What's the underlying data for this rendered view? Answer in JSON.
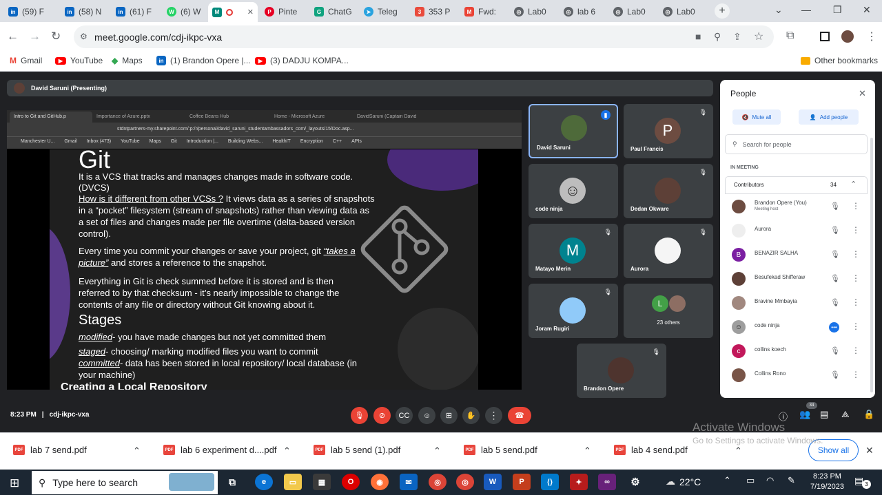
{
  "browser": {
    "tabs": [
      {
        "label": "(59) F",
        "icon": "linkedin-icon",
        "color": "#0a66c2",
        "glyph": "in"
      },
      {
        "label": "(58) N",
        "icon": "linkedin-icon",
        "color": "#0a66c2",
        "glyph": "in"
      },
      {
        "label": "(61) F",
        "icon": "linkedin-icon",
        "color": "#0a66c2",
        "glyph": "in"
      },
      {
        "label": "(6) W",
        "icon": "whatsapp-icon",
        "color": "#25d366",
        "glyph": "W"
      },
      {
        "label": "",
        "icon": "meet-icon",
        "color": "#00897b",
        "glyph": "M"
      },
      {
        "label": "Pinte",
        "icon": "pinterest-icon",
        "color": "#e60023",
        "glyph": "P"
      },
      {
        "label": "ChatG",
        "icon": "chatgpt-icon",
        "color": "#10a37f",
        "glyph": "G"
      },
      {
        "label": "Teleg",
        "icon": "telegram-icon",
        "color": "#2aa3df",
        "glyph": "T"
      },
      {
        "label": "353 P",
        "icon": "tab-app-icon",
        "color": "#e94b3c",
        "glyph": "3"
      },
      {
        "label": "Fwd:",
        "icon": "gmail-icon",
        "color": "#ea4335",
        "glyph": "M"
      },
      {
        "label": "Lab0",
        "icon": "globe-icon",
        "color": "#5f6368",
        "glyph": "◎"
      },
      {
        "label": "lab 6",
        "icon": "globe-icon",
        "color": "#5f6368",
        "glyph": "◎"
      },
      {
        "label": "Lab0",
        "icon": "globe-icon",
        "color": "#5f6368",
        "glyph": "◎"
      },
      {
        "label": "Lab0",
        "icon": "globe-icon",
        "color": "#5f6368",
        "glyph": "◎"
      }
    ],
    "url": "meet.google.com/cdj-ikpc-vxa",
    "bookmarks": [
      "Gmail",
      "YouTube",
      "Maps",
      "(1) Brandon Opere |...",
      "(3) DADJU KOMPA..."
    ],
    "other_bookmarks": "Other bookmarks"
  },
  "meet": {
    "presenter": "David Saruni (Presenting)",
    "time": "8:23 PM",
    "code": "cdj-ikpc-vxa",
    "participant_badge": "34"
  },
  "shared": {
    "tabs": [
      "Intro to Git and GitHub.p",
      "Importance of Azure.pptx",
      "Coffee Beans Hub",
      "Home - Microsoft Azure",
      "DavidSaruni (Captain David"
    ],
    "url": "stdntpartners-my.sharepoint.com/:p:/r/personal/david_saruni_studentambassadors_com/_layouts/15/Doc.asp...",
    "bookmarks": [
      "Manchester U...",
      "Gmail",
      "Inbox (473)",
      "YouTube",
      "Maps",
      "Git",
      "Introduction |...",
      "Building Webs...",
      "HealthIT",
      "Encryption",
      "C++",
      "APIs"
    ]
  },
  "slide": {
    "title": "Git",
    "p1": "It is a VCS that tracks and manages changes made in software code. (DVCS)",
    "p2_link": "How is it different from other VCSs ?",
    "p2": " It views data as a series of snapshots in a “pocket” filesystem (stream of snapshots) rather than viewing data as a set of files and changes made per file overtime (delta-based version control).",
    "p3": "Every time you commit your changes or save your project, git ",
    "p3_link": "“takes a picture”",
    "p3_end": " and stores a reference to the snapshot.",
    "p4": "Everything in Git is check summed before it is stored and is then referred to by that checksum - it’s nearly impossible to change the contents of any file or directory without Git knowing about it.",
    "stages": "Stages",
    "s1_term": "modified",
    "s1": "- you have made changes but not yet committed them",
    "s2_term": "staged",
    "s2": "- choosing/ marking modified files you want to commit",
    "s3_term": "committed",
    "s3": "- data has been stored in local repository/ local database (in your machine)",
    "next": "Creating a Local Repository"
  },
  "tiles": [
    {
      "name": "David Saruni",
      "initial": ""
    },
    {
      "name": "Paul Francis",
      "initial": "P"
    },
    {
      "name": "code ninja",
      "initial": ""
    },
    {
      "name": "Dedan Okware",
      "initial": ""
    },
    {
      "name": "Matayo Merin",
      "initial": "M"
    },
    {
      "name": "Aurora",
      "initial": ""
    },
    {
      "name": "Joram Rugiri",
      "initial": ""
    },
    {
      "name": "23 others",
      "initial": "L"
    },
    {
      "name": "Brandon Opere",
      "initial": ""
    }
  ],
  "people": {
    "title": "People",
    "mute_all": "Mute all",
    "add_people": "Add people",
    "search_placeholder": "Search for people",
    "in_meeting": "IN MEETING",
    "contributors": "Contributors",
    "count": "34",
    "list": [
      {
        "name": "Brandon Opere (You)",
        "sub": "Meeting host",
        "initial": "",
        "color": "#6d4c41"
      },
      {
        "name": "Aurora",
        "sub": "",
        "initial": "",
        "color": "#e0e0e0"
      },
      {
        "name": "BENAZIR SALHA",
        "sub": "",
        "initial": "B",
        "color": "#7b1fa2"
      },
      {
        "name": "Besufekad Shifferaw",
        "sub": "",
        "initial": "",
        "color": "#5d4037"
      },
      {
        "name": "Bravine Mmbayia",
        "sub": "",
        "initial": "",
        "color": "#a1887f"
      },
      {
        "name": "code ninja",
        "sub": "",
        "initial": "",
        "color": "#9e9e9e"
      },
      {
        "name": "collins koech",
        "sub": "",
        "initial": "c",
        "color": "#c2185b"
      },
      {
        "name": "Collins Rono",
        "sub": "",
        "initial": "",
        "color": "#795548"
      }
    ]
  },
  "downloads": [
    "lab 7 send.pdf",
    "lab 6 experiment d....pdf",
    "lab 5 send (1).pdf",
    "lab 5 send.pdf",
    "lab 4 send.pdf"
  ],
  "show_all": "Show all",
  "watermark": {
    "line1": "Activate Windows",
    "line2": "Go to Settings to activate Windows."
  },
  "taskbar": {
    "search": "Type here to search",
    "temp": "22°C",
    "time": "8:23 PM",
    "date": "7/19/2023",
    "notif": "3"
  }
}
